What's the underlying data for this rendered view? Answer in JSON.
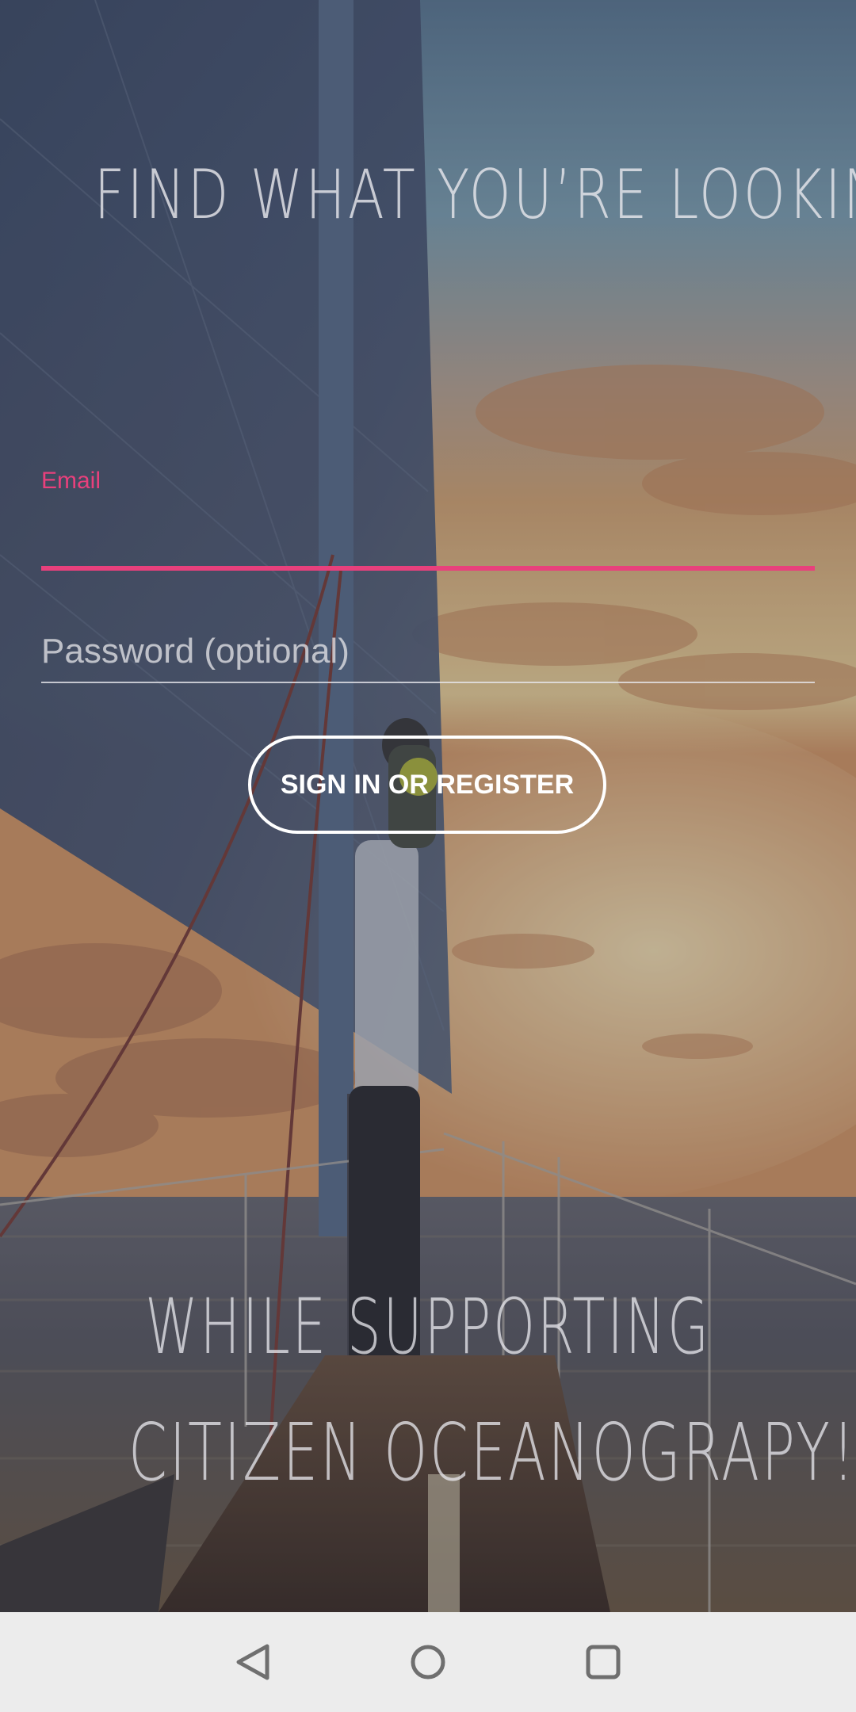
{
  "headline": "FIND WHAT YOU’RE LOOKING FOR",
  "form": {
    "email_label": "Email",
    "email_value": "",
    "password_placeholder": "Password (optional)",
    "password_value": "",
    "submit_label": "SIGN IN OR REGISTER"
  },
  "tagline": {
    "line1": "WHILE SUPPORTING",
    "line2": "CITIZEN OCEANOGRAPY!"
  },
  "colors": {
    "accent": "#e8407c",
    "button_border": "#ffffff",
    "nav_bar": "#ececec"
  },
  "nav": {
    "back_icon": "back-triangle-icon",
    "home_icon": "home-circle-icon",
    "recent_icon": "recent-apps-square-icon"
  }
}
